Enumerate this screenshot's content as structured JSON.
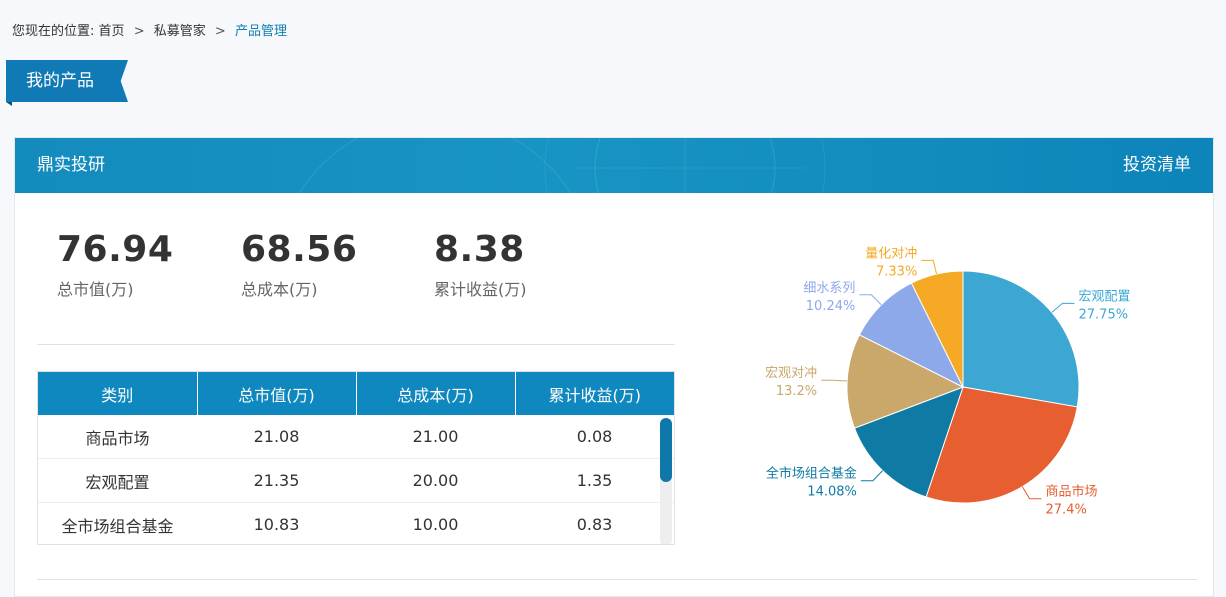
{
  "breadcrumb": {
    "prefix": "您现在的位置:",
    "items": [
      "首页",
      "私募管家",
      "产品管理"
    ],
    "separator": ">"
  },
  "section": {
    "title": "我的产品"
  },
  "card": {
    "title": "鼎实投研",
    "link": "投资清单"
  },
  "stats": [
    {
      "value": "76.94",
      "label": "总市值(万)"
    },
    {
      "value": "68.56",
      "label": "总成本(万)"
    },
    {
      "value": "8.38",
      "label": "累计收益(万)"
    }
  ],
  "table": {
    "headers": [
      "类别",
      "总市值(万)",
      "总成本(万)",
      "累计收益(万)"
    ],
    "rows": [
      [
        "商品市场",
        "21.08",
        "21.00",
        "0.08"
      ],
      [
        "宏观配置",
        "21.35",
        "20.00",
        "1.35"
      ],
      [
        "全市场组合基金",
        "10.83",
        "10.00",
        "0.83"
      ]
    ]
  },
  "chart_data": {
    "type": "pie",
    "slices": [
      {
        "label": "宏观配置",
        "percent_label": "27.75%",
        "value": 27.75,
        "color": "#3da7d3"
      },
      {
        "label": "商品市场",
        "percent_label": "27.4%",
        "value": 27.4,
        "color": "#e75f30"
      },
      {
        "label": "全市场组合基金",
        "percent_label": "14.08%",
        "value": 14.08,
        "color": "#0f7aa4"
      },
      {
        "label": "宏观对冲",
        "percent_label": "13.2%",
        "value": 13.2,
        "color": "#caa76a"
      },
      {
        "label": "细水系列",
        "percent_label": "10.24%",
        "value": 10.24,
        "color": "#8ea9ea"
      },
      {
        "label": "量化对冲",
        "percent_label": "7.33%",
        "value": 7.33,
        "color": "#f5a924"
      }
    ]
  }
}
